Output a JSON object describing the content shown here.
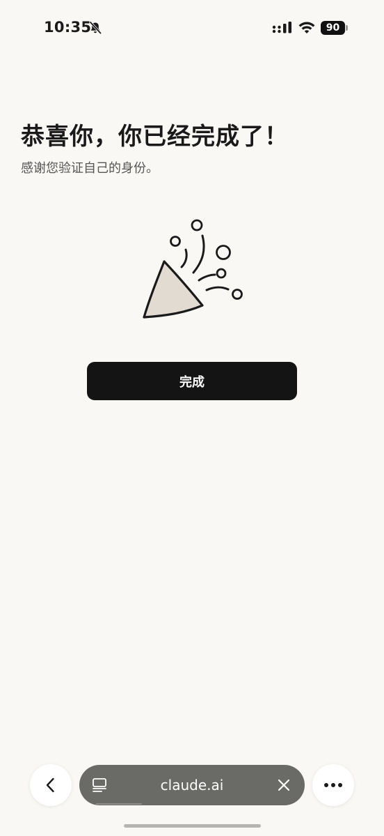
{
  "status_bar": {
    "time": "10:35",
    "battery": "90",
    "icons": [
      "bell-slash-icon",
      "signal-icon",
      "wifi-icon",
      "battery-icon"
    ]
  },
  "main": {
    "title": "恭喜你，你已经完成了！",
    "subtitle": "感谢您验证自己的身份。",
    "illustration": "party-popper-icon",
    "done_button": "完成"
  },
  "browser_bar": {
    "url": "claude.ai",
    "icons": [
      "back-chevron-icon",
      "tabs-icon",
      "close-icon",
      "more-icon"
    ]
  },
  "colors": {
    "background": "#f9f8f5",
    "button": "#141414",
    "url_pill": "#6a6a66",
    "illustration_fill": "#e2dbd1"
  }
}
